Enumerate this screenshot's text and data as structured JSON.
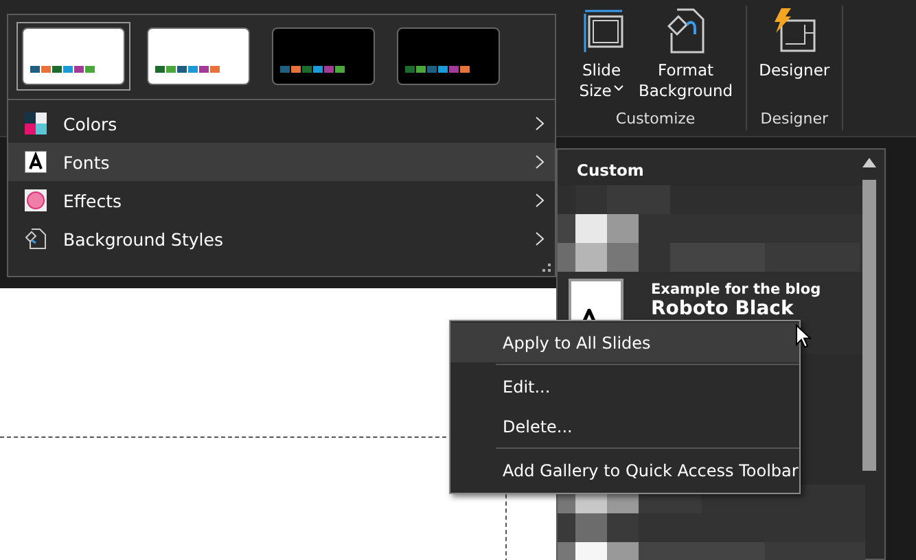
{
  "ribbon": {
    "groups": [
      {
        "label": "Customize",
        "buttons": [
          {
            "kind": "slide-size",
            "label_lines": [
              "Slide",
              "Size"
            ],
            "has_caret": true
          },
          {
            "kind": "format-background",
            "label_lines": [
              "Format",
              "Background"
            ],
            "has_caret": false
          }
        ]
      },
      {
        "label": "Designer",
        "buttons": [
          {
            "kind": "designer",
            "label_lines": [
              "Designer"
            ],
            "has_caret": false
          }
        ]
      }
    ]
  },
  "variants_panel": {
    "variants": [
      {
        "selected": true,
        "kind": "light",
        "swatches": [
          {
            "color": "#1f5f7f"
          },
          {
            "color": "#e8733a"
          },
          {
            "color": "#1e6b2e"
          },
          {
            "color": "#1a9bd7"
          },
          {
            "color": "#a23a98"
          },
          {
            "color": "#4aa83a"
          }
        ]
      },
      {
        "selected": false,
        "kind": "light",
        "swatches": [
          {
            "color": "#1e6b2e"
          },
          {
            "color": "#4aa83a"
          },
          {
            "color": "#1f5f7f"
          },
          {
            "color": "#1a9bd7"
          },
          {
            "color": "#a23a98"
          },
          {
            "color": "#e8733a"
          }
        ]
      },
      {
        "selected": false,
        "kind": "dark",
        "swatches": [
          {
            "color": "#1f5f7f"
          },
          {
            "color": "#e8733a"
          },
          {
            "color": "#1e6b2e"
          },
          {
            "color": "#1a9bd7"
          },
          {
            "color": "#a23a98"
          },
          {
            "color": "#4aa83a"
          }
        ]
      },
      {
        "selected": false,
        "kind": "dark",
        "swatches": [
          {
            "color": "#1e6b2e"
          },
          {
            "color": "#4aa83a"
          },
          {
            "color": "#1f5f7f"
          },
          {
            "color": "#1a9bd7"
          },
          {
            "color": "#a23a98"
          },
          {
            "color": "#e8733a"
          }
        ]
      }
    ],
    "menu": [
      {
        "kind": "colors",
        "label": "Colors",
        "selected": false
      },
      {
        "kind": "fonts",
        "label": "Fonts",
        "selected": true
      },
      {
        "kind": "effects",
        "label": "Effects",
        "selected": false
      },
      {
        "kind": "background",
        "label": "Background Styles",
        "selected": false
      }
    ]
  },
  "fonts_submenu": {
    "header": "Custom",
    "item": {
      "title": "Example for the blog",
      "font_name": "Roboto Black"
    }
  },
  "context_menu": [
    {
      "kind": "item",
      "label": "Apply to All Slides",
      "selected": true
    },
    {
      "kind": "separator"
    },
    {
      "kind": "item",
      "label": "Edit...",
      "selected": false
    },
    {
      "kind": "item",
      "label": "Delete...",
      "selected": false
    },
    {
      "kind": "separator"
    },
    {
      "kind": "item",
      "label": "Add Gallery to Quick Access Toolbar",
      "selected": false
    }
  ]
}
